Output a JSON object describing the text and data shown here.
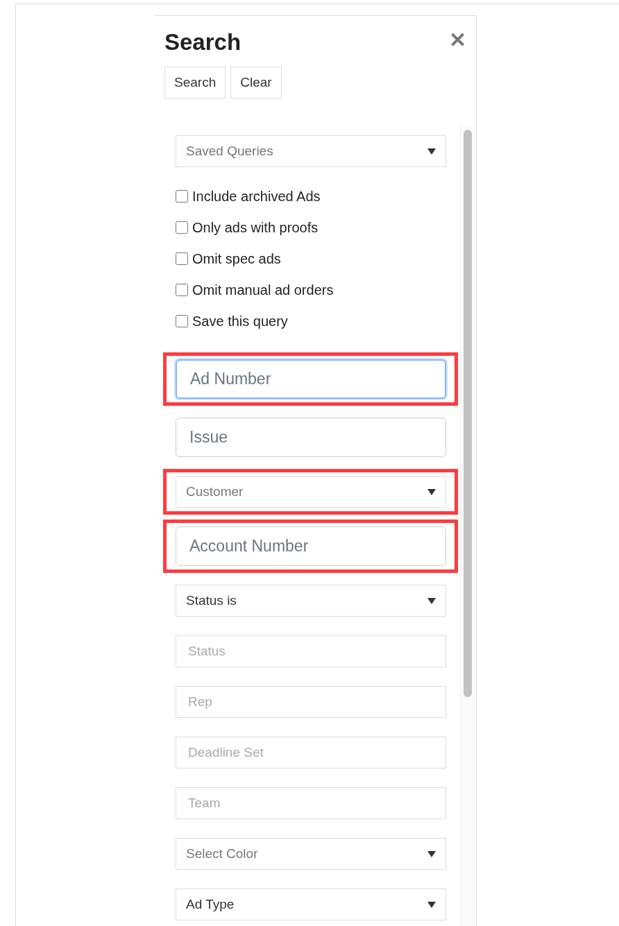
{
  "panel": {
    "title": "Search",
    "close": "✕"
  },
  "buttons": [
    "Search",
    "Clear"
  ],
  "saved_queries": {
    "placeholder": "Saved Queries"
  },
  "options": [
    {
      "label": "Include archived Ads",
      "checked": false
    },
    {
      "label": "Only ads with proofs",
      "checked": false
    },
    {
      "label": "Omit spec ads",
      "checked": false
    },
    {
      "label": "Omit manual ad orders",
      "checked": false
    },
    {
      "label": "Save this query",
      "checked": false
    }
  ],
  "fields": [
    {
      "kind": "input-large",
      "placeholder": "Ad Number",
      "focused": true,
      "highlighted": true
    },
    {
      "kind": "input-large",
      "placeholder": "Issue",
      "focused": false
    },
    {
      "kind": "select",
      "placeholder": "Customer",
      "highlighted": true
    },
    {
      "kind": "input-large",
      "placeholder": "Account Number",
      "focused": false,
      "highlighted": true
    },
    {
      "kind": "select",
      "value": "Status is"
    },
    {
      "kind": "input",
      "placeholder": "Status",
      "focused": false
    },
    {
      "kind": "input",
      "placeholder": "Rep",
      "focused": false
    },
    {
      "kind": "input",
      "placeholder": "Deadline Set",
      "focused": false
    },
    {
      "kind": "input",
      "placeholder": "Team",
      "focused": false
    },
    {
      "kind": "select",
      "placeholder": "Select Color"
    },
    {
      "kind": "select",
      "value": "Ad Type"
    }
  ]
}
